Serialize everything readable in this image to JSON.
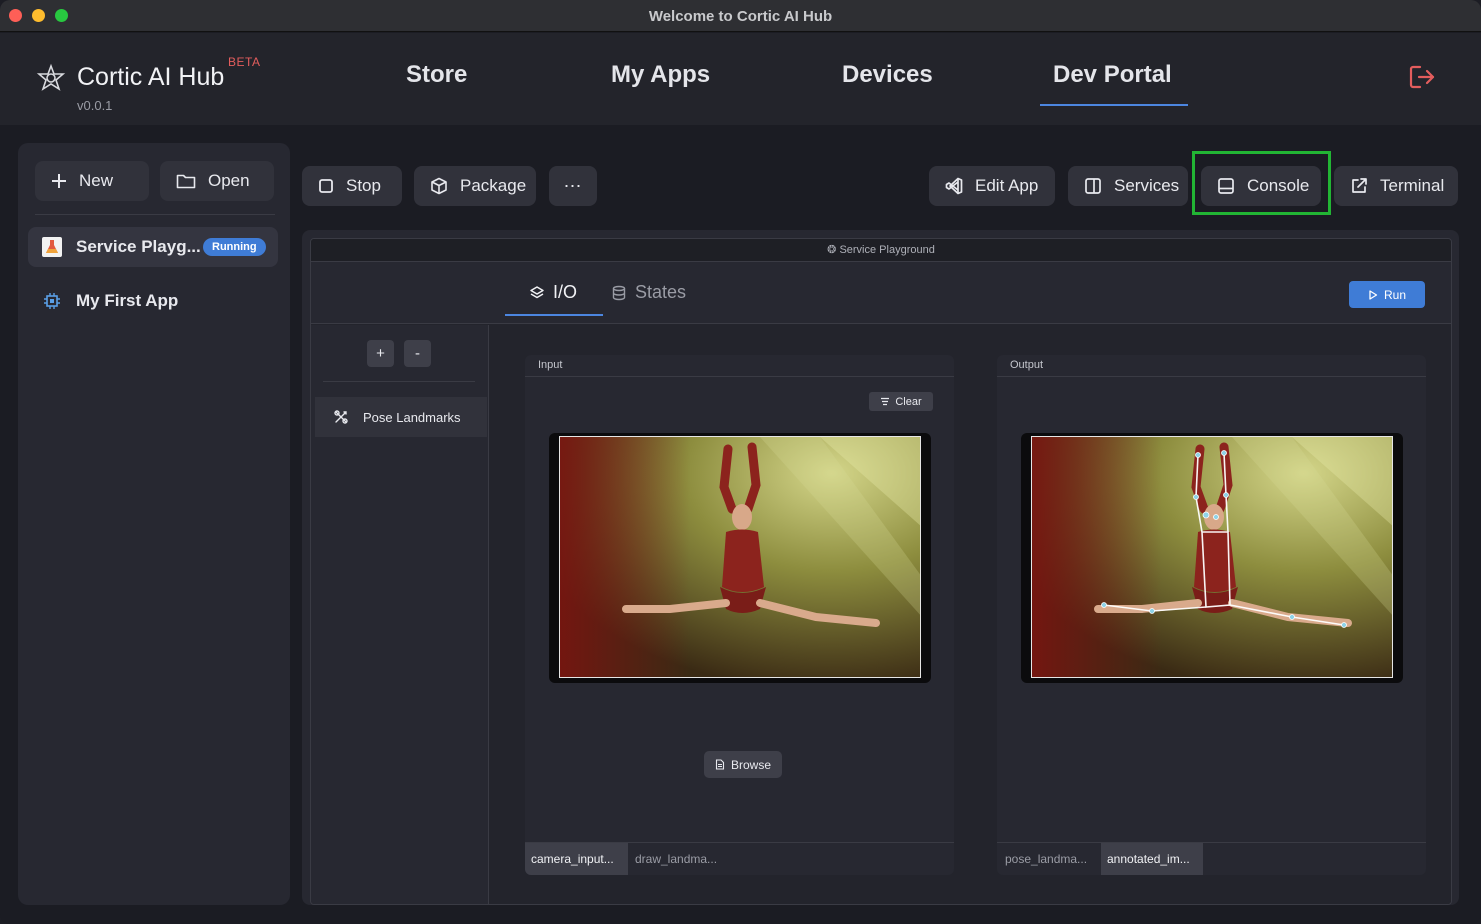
{
  "window": {
    "title": "Welcome to Cortic AI Hub"
  },
  "header": {
    "brand": "Cortic AI Hub",
    "beta": "BETA",
    "version": "v0.0.1",
    "nav": [
      "Store",
      "My Apps",
      "Devices",
      "Dev Portal"
    ],
    "active_nav": "Dev Portal"
  },
  "sidebar": {
    "new_label": "New",
    "open_label": "Open",
    "items": [
      {
        "label": "Service Playg...",
        "badge": "Running",
        "icon": "flask-icon"
      },
      {
        "label": "My First App",
        "icon": "chip-icon"
      }
    ]
  },
  "toolbar": {
    "stop": "Stop",
    "package": "Package",
    "more": "⋯",
    "edit_app": "Edit App",
    "services": "Services",
    "console": "Console",
    "terminal": "Terminal"
  },
  "playground": {
    "title": "Service Playground",
    "tabs": [
      "I/O",
      "States"
    ],
    "active_tab": "I/O",
    "run": "Run",
    "plus": "+",
    "minus": "-",
    "services": [
      "Pose Landmarks"
    ],
    "input": {
      "heading": "Input",
      "clear": "Clear",
      "browse": "Browse",
      "tabs": [
        "camera_input...",
        "draw_landma..."
      ],
      "active_tab": "camera_input..."
    },
    "output": {
      "heading": "Output",
      "tabs": [
        "pose_landma...",
        "annotated_im..."
      ],
      "active_tab": "annotated_im..."
    }
  },
  "colors": {
    "accent": "#3f7cd6",
    "highlight": "#22b534",
    "logout": "#e35d5d"
  }
}
